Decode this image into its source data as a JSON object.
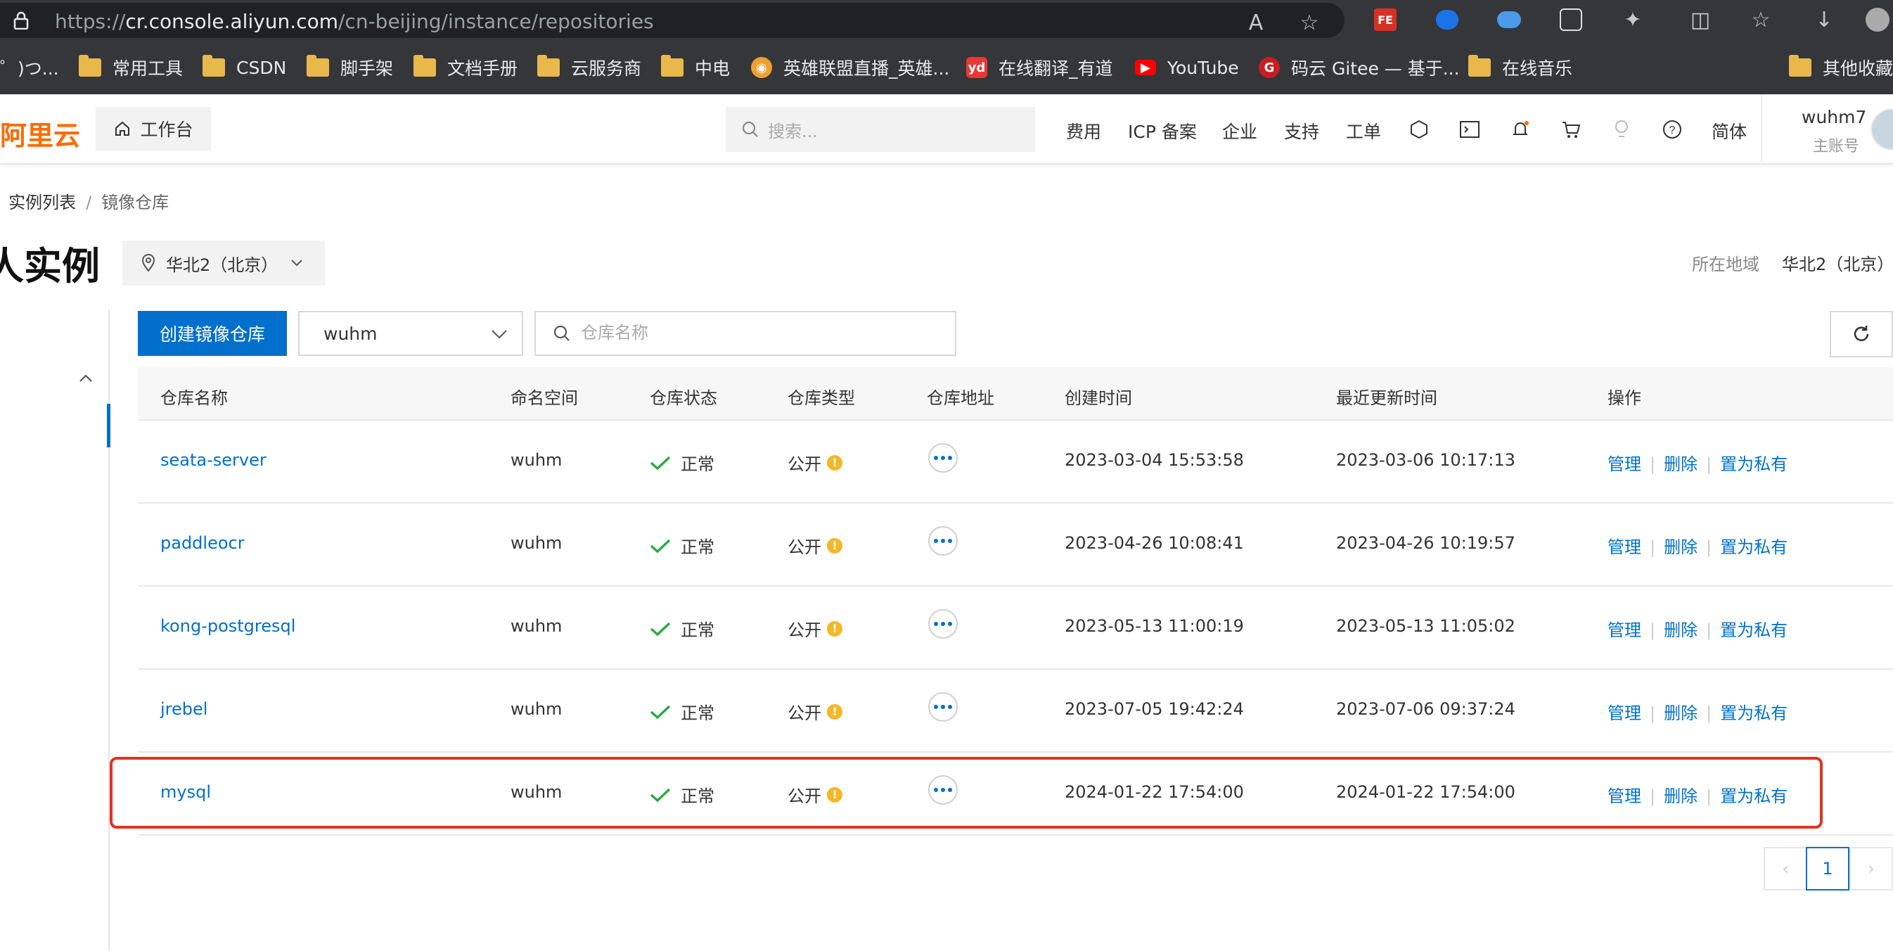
{
  "browser": {
    "url_prefix": "https://",
    "url_host": "cr.console.aliyun.com",
    "url_path": "/cn-beijing/instance/repositories",
    "bookmarks": [
      {
        "label": "゜)つ..."
      },
      {
        "label": "常用工具"
      },
      {
        "label": "CSDN"
      },
      {
        "label": "脚手架"
      },
      {
        "label": "文档手册"
      },
      {
        "label": "云服务商"
      },
      {
        "label": "中电"
      },
      {
        "label": "英雄联盟直播_英雄..."
      },
      {
        "label": "在线翻译_有道"
      },
      {
        "label": "YouTube"
      },
      {
        "label": "码云 Gitee — 基于..."
      },
      {
        "label": "在线音乐"
      },
      {
        "label": "其他收藏夹"
      }
    ]
  },
  "header": {
    "logo": "阿里云",
    "workbench": "工作台",
    "search_placeholder": "搜索...",
    "nav": [
      "费用",
      "ICP 备案",
      "企业",
      "支持",
      "工单"
    ],
    "lang": "简体",
    "user_name": "wuhm7",
    "user_role": "主账号"
  },
  "breadcrumb": {
    "items": [
      "实例列表",
      "镜像仓库"
    ]
  },
  "page": {
    "title": "人实例",
    "region": "华北2（北京）",
    "region_label": "所在地域",
    "region_value": "华北2（北京）"
  },
  "toolbar": {
    "create_label": "创建镜像仓库",
    "namespace": "wuhm",
    "search_placeholder": "仓库名称"
  },
  "table": {
    "columns": [
      "仓库名称",
      "命名空间",
      "仓库状态",
      "仓库类型",
      "仓库地址",
      "创建时间",
      "最近更新时间",
      "操作"
    ],
    "rows": [
      {
        "name": "seata-server",
        "namespace": "wuhm",
        "status": "正常",
        "type": "公开",
        "created": "2023-03-04 15:53:58",
        "updated": "2023-03-06 10:17:13"
      },
      {
        "name": "paddleocr",
        "namespace": "wuhm",
        "status": "正常",
        "type": "公开",
        "created": "2023-04-26 10:08:41",
        "updated": "2023-04-26 10:19:57"
      },
      {
        "name": "kong-postgresql",
        "namespace": "wuhm",
        "status": "正常",
        "type": "公开",
        "created": "2023-05-13 11:00:19",
        "updated": "2023-05-13 11:05:02"
      },
      {
        "name": "jrebel",
        "namespace": "wuhm",
        "status": "正常",
        "type": "公开",
        "created": "2023-07-05 19:42:24",
        "updated": "2023-07-06 09:37:24"
      },
      {
        "name": "mysql",
        "namespace": "wuhm",
        "status": "正常",
        "type": "公开",
        "created": "2024-01-22 17:54:00",
        "updated": "2024-01-22 17:54:00"
      }
    ],
    "actions": [
      "管理",
      "删除",
      "置为私有"
    ]
  },
  "pagination": {
    "current": "1"
  },
  "colors": {
    "primary": "#0070cc",
    "brand": "#ff6a00",
    "success": "#2eaa46",
    "warning": "#f5b728",
    "highlight": "#e3321f"
  }
}
